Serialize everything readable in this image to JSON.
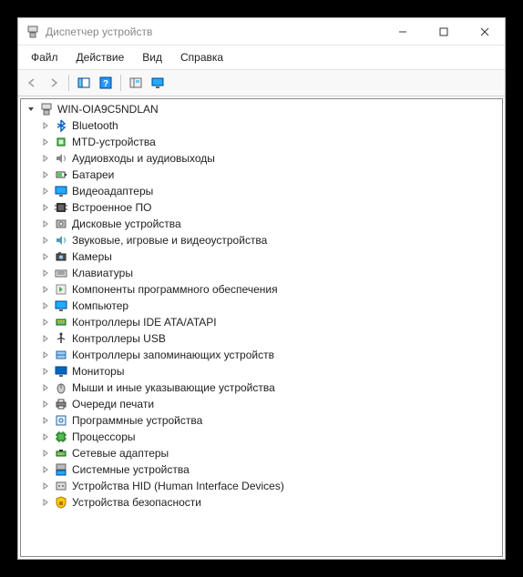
{
  "window": {
    "title": "Диспетчер устройств"
  },
  "menubar": {
    "items": [
      {
        "label": "Файл"
      },
      {
        "label": "Действие"
      },
      {
        "label": "Вид"
      },
      {
        "label": "Справка"
      }
    ]
  },
  "toolbar": {
    "back": "←",
    "forward": "→"
  },
  "tree": {
    "root": {
      "label": "WIN-OIA9C5NDLAN",
      "expanded": true
    },
    "items": [
      {
        "label": "Bluetooth",
        "icon": "bluetooth"
      },
      {
        "label": "MTD-устройства",
        "icon": "chip"
      },
      {
        "label": "Аудиовходы и аудиовыходы",
        "icon": "audio"
      },
      {
        "label": "Батареи",
        "icon": "battery"
      },
      {
        "label": "Видеоадаптеры",
        "icon": "display"
      },
      {
        "label": "Встроенное ПО",
        "icon": "firmware"
      },
      {
        "label": "Дисковые устройства",
        "icon": "disk"
      },
      {
        "label": "Звуковые, игровые и видеоустройства",
        "icon": "sound"
      },
      {
        "label": "Камеры",
        "icon": "camera"
      },
      {
        "label": "Клавиатуры",
        "icon": "keyboard"
      },
      {
        "label": "Компоненты программного обеспечения",
        "icon": "software"
      },
      {
        "label": "Компьютер",
        "icon": "computer"
      },
      {
        "label": "Контроллеры IDE ATA/ATAPI",
        "icon": "ide"
      },
      {
        "label": "Контроллеры USB",
        "icon": "usb"
      },
      {
        "label": "Контроллеры запоминающих устройств",
        "icon": "storage"
      },
      {
        "label": "Мониторы",
        "icon": "monitor"
      },
      {
        "label": "Мыши и иные указывающие устройства",
        "icon": "mouse"
      },
      {
        "label": "Очереди печати",
        "icon": "printer"
      },
      {
        "label": "Программные устройства",
        "icon": "softdev"
      },
      {
        "label": "Процессоры",
        "icon": "cpu"
      },
      {
        "label": "Сетевые адаптеры",
        "icon": "network"
      },
      {
        "label": "Системные устройства",
        "icon": "system"
      },
      {
        "label": "Устройства HID (Human Interface Devices)",
        "icon": "hid"
      },
      {
        "label": "Устройства безопасности",
        "icon": "security"
      }
    ]
  }
}
